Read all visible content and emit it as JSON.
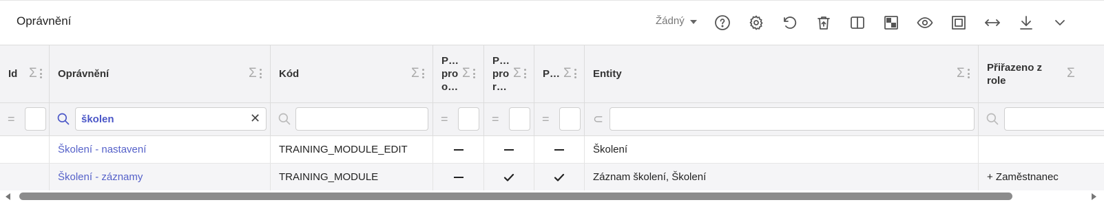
{
  "toolbar": {
    "title": "Oprávnění",
    "view_select": "Žádný",
    "icons": [
      "help-icon",
      "settings-icon",
      "undo-icon",
      "delete-icon",
      "columns-icon",
      "layout-icon",
      "visibility-icon",
      "fullscreen-icon",
      "fit-width-icon",
      "download-icon",
      "chevron-down-icon"
    ]
  },
  "columns": [
    {
      "label": "Id"
    },
    {
      "label": "Oprávnění"
    },
    {
      "label": "Kód"
    },
    {
      "label": "P… pro o…"
    },
    {
      "label": "P… pro r…"
    },
    {
      "label": "P…"
    },
    {
      "label": "Entity"
    },
    {
      "label": "Přiřazeno z role"
    }
  ],
  "header_lines": {
    "c3": [
      "P…",
      "pro",
      "o…"
    ],
    "c4": [
      "P…",
      "pro",
      "r…"
    ],
    "c7": [
      "Přiřazeno z",
      "role"
    ]
  },
  "filters": {
    "col0_op": "=",
    "col1_value": "školen",
    "col2_value": "",
    "col3_op": "=",
    "col4_op": "=",
    "col5_op": "=",
    "col6_op": "⊂",
    "col6_value": ""
  },
  "rows": [
    {
      "id": "",
      "name": "Školení - nastavení",
      "code": "TRAINING_MODULE_EDIT",
      "p1": "dash",
      "p2": "dash",
      "p3": "dash",
      "entity": "Školení",
      "role": ""
    },
    {
      "id": "",
      "name": "Školení - záznamy",
      "code": "TRAINING_MODULE",
      "p1": "dash",
      "p2": "check",
      "p3": "check",
      "entity": "Záznam školení, Školení",
      "role": "+ Zaměstnanec"
    }
  ],
  "scrollbar": {
    "thumb_fraction": 0.93
  },
  "colors": {
    "link": "#5561c9",
    "header_bg": "#f3f3f5",
    "alt_row_bg": "#f5f5f7"
  }
}
